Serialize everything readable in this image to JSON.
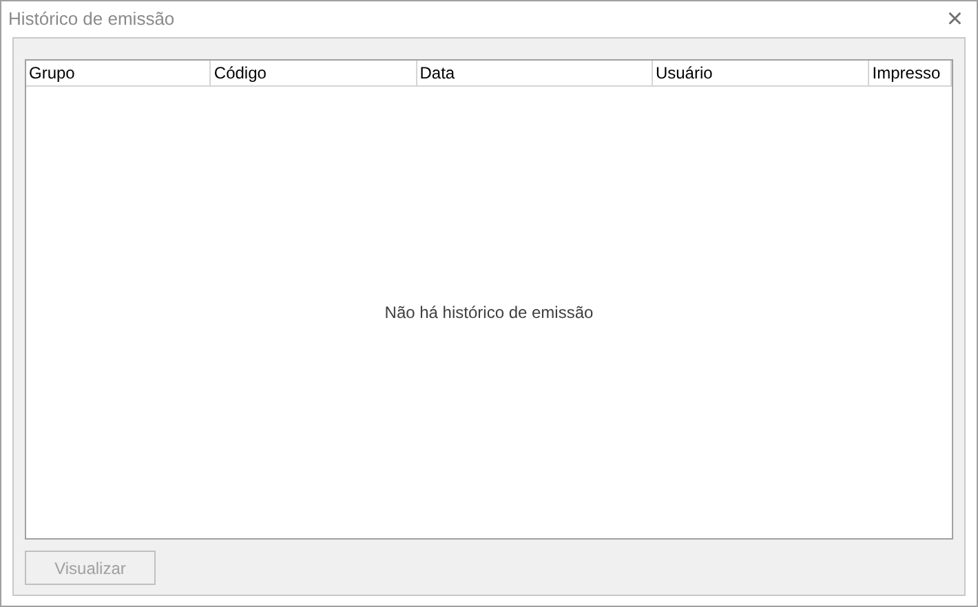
{
  "window": {
    "title": "Histórico de emissão",
    "close": "×"
  },
  "table": {
    "columns": [
      "Grupo",
      "Código",
      "Data",
      "Usuário",
      "Impresso"
    ],
    "empty_message": "Não há histórico de emissão"
  },
  "buttons": [
    {
      "label": "Visualizar",
      "disabled": true
    }
  ]
}
